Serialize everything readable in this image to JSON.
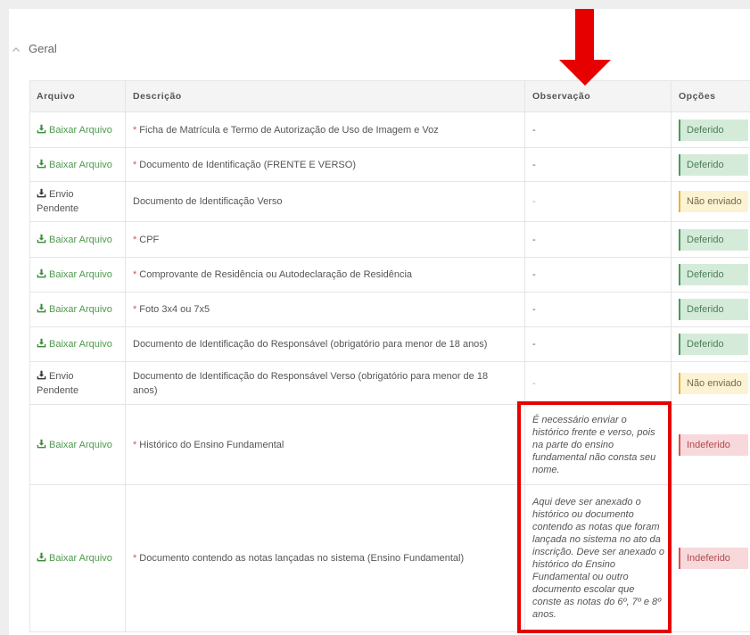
{
  "section": {
    "title": "Geral"
  },
  "table": {
    "headers": {
      "file": "Arquivo",
      "description": "Descrição",
      "observation": "Observação",
      "options": "Opções"
    },
    "rows": [
      {
        "file": "Baixar Arquivo",
        "required": "*",
        "description": "Ficha de Matrícula e Termo de Autorização de Uso de Imagem e Voz",
        "observation": "-",
        "status": "Deferido"
      },
      {
        "file": "Baixar Arquivo",
        "required": "*",
        "description": "Documento de Identificação (FRENTE E VERSO)",
        "observation": "-",
        "status": "Deferido"
      },
      {
        "file": "Envio Pendente",
        "description": "Documento de Identificação Verso",
        "observation": "-",
        "status": "Não enviado"
      },
      {
        "file": "Baixar Arquivo",
        "required": "*",
        "description": "CPF",
        "observation": "-",
        "status": "Deferido"
      },
      {
        "file": "Baixar Arquivo",
        "required": "*",
        "description": "Comprovante de Residência ou Autodeclaração de Residência",
        "observation": "-",
        "status": "Deferido"
      },
      {
        "file": "Baixar Arquivo",
        "required": "*",
        "description": "Foto 3x4 ou 7x5",
        "observation": "-",
        "status": "Deferido"
      },
      {
        "file": "Baixar Arquivo",
        "description": "Documento de Identificação do Responsável (obrigatório para menor de 18 anos)",
        "observation": "-",
        "status": "Deferido"
      },
      {
        "file": "Envio Pendente",
        "description": "Documento de Identificação do Responsável Verso (obrigatório para menor de 18 anos)",
        "observation": "-",
        "status": "Não enviado"
      },
      {
        "file": "Baixar Arquivo",
        "required": "*",
        "description": "Histórico do Ensino Fundamental",
        "observation": "É necessário enviar o histórico frente e verso, pois na parte do ensino fundamental não consta seu nome.",
        "status": "Indeferido"
      },
      {
        "file": "Baixar Arquivo",
        "required": "*",
        "description": "Documento contendo as notas lançadas no sistema (Ensino Fundamental)",
        "observation": "Aqui deve ser anexado o histórico ou documento contendo as notas que foram lançada no sistema no ato da inscrição. Deve ser anexado o histórico do Ensino Fundamental ou outro documento escolar que conste as notas do 6º, 7º e 8º anos.",
        "status": "Indeferido"
      }
    ]
  },
  "icons": {
    "section_toggle": "chevron-up-icon",
    "file": "download-icon",
    "annotation": "arrow-down-icon"
  },
  "colors": {
    "link_green": "#4e9a4e",
    "required_red": "#d9534f",
    "annotation_red": "#e60000",
    "status_deferido": "#d5ebd9",
    "status_nao_enviado": "#fcf3d5",
    "status_indeferido": "#f7d9dc"
  }
}
